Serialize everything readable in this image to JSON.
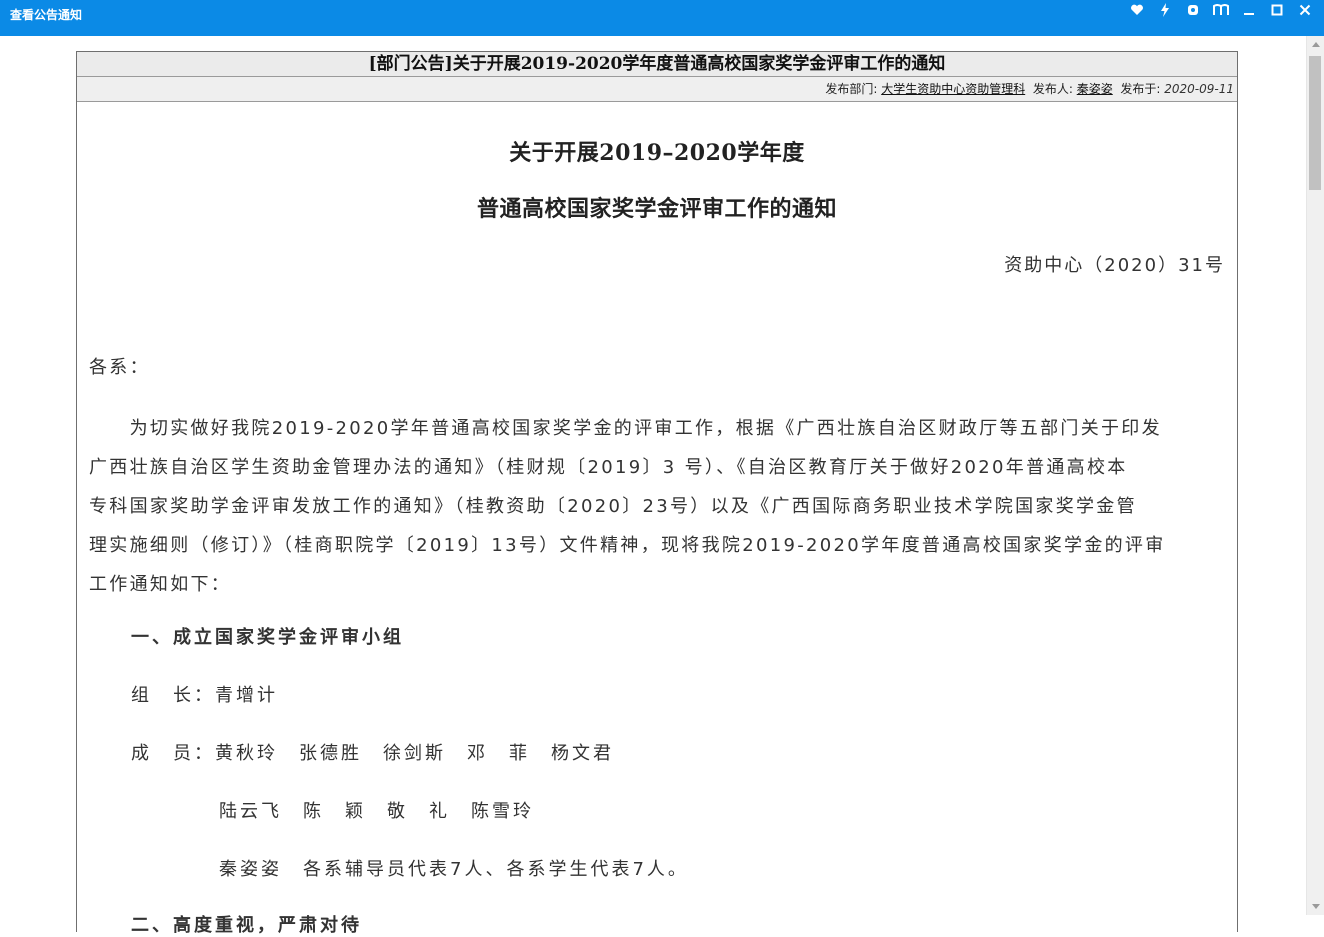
{
  "window": {
    "title": "查看公告通知",
    "controls": [
      "heart-icon",
      "lightning-icon",
      "settings-icon",
      "reader-icon",
      "minimize-icon",
      "maximize-icon",
      "close-icon"
    ]
  },
  "notice": {
    "header_title": "[部门公告]关于开展2019-2020学年度普通高校国家奖学金评审工作的通知",
    "meta": {
      "dept_label": "发布部门:",
      "dept_value": "大学生资助中心资助管理科",
      "publisher_label": "发布人:",
      "publisher_value": "秦姿姿",
      "date_label": "发布于:",
      "date_value": "2020-09-11"
    },
    "title_line1": "关于开展2019–2020学年度",
    "title_line2": "普通高校国家奖学金评审工作的通知",
    "doc_number": "资助中心（2020）31号",
    "salutation": "各系：",
    "paragraph_lines": [
      "　　为切实做好我院2019-2020学年普通高校国家奖学金的评审工作，根据《广西壮族自治区财政厅等五部门关于印发",
      "广西壮族自治区学生资助金管理办法的通知》（桂财规〔2019〕3 号）、《自治区教育厅关于做好2020年普通高校本",
      "专科国家奖助学金评审发放工作的通知》（桂教资助〔2020〕23号）以及《广西国际商务职业技术学院国家奖学金管",
      "理实施细则（修订）》（桂商职院学〔2019〕13号）文件精神，现将我院2019-2020学年度普通高校国家奖学金的评审",
      "工作通知如下："
    ],
    "section1": "一、成立国家奖学金评审小组",
    "leader": "组　长：青增计",
    "members1": "成　员：黄秋玲　张德胜　徐剑斯　邓　菲　杨文君",
    "members2": "陆云飞　陈　颖　敬　礼　陈雪玲",
    "members3": "秦姿姿　各系辅导员代表7人、各系学生代表7人。",
    "section2": "二、高度重视，严肃对待"
  }
}
